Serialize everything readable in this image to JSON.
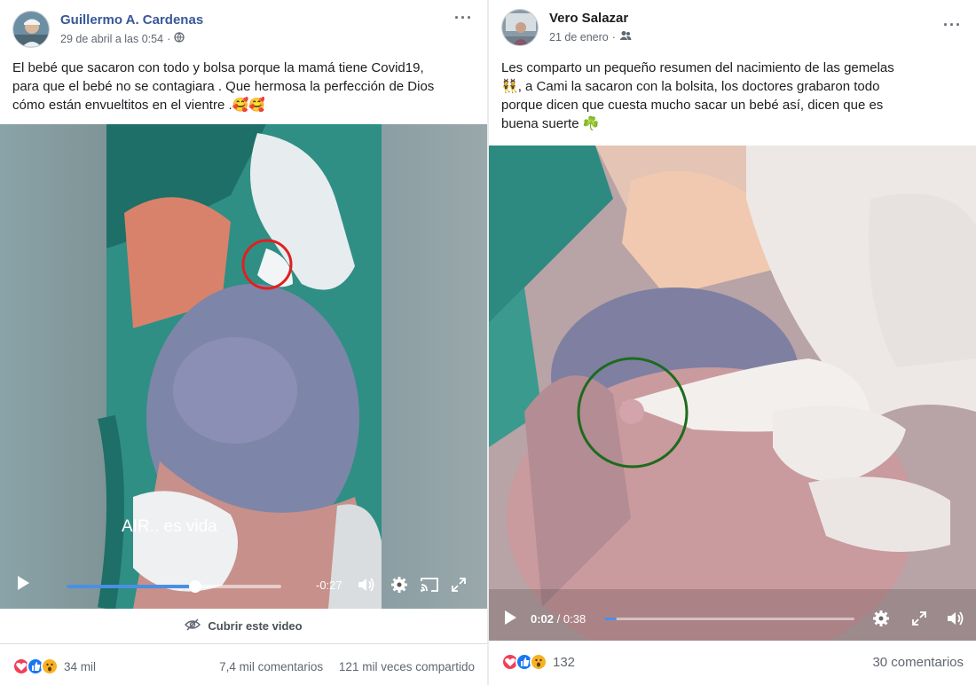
{
  "left_post": {
    "author": "Guillermo A. Cardenas",
    "timestamp": "29 de abril a las 0:54",
    "audience_icon": "globe-icon",
    "caption_lines": [
      "El bebé que sacaron con todo y bolsa porque la mamá tiene Covid19,",
      "para que el bebé no se contagiara . Que hermosa la perfección de Dios",
      "cómo están envueltitos en el vientre ."
    ],
    "caption_emoji": "🥰🥰",
    "video": {
      "overlay_text": "AIR.. es vida",
      "time_remaining": "-0:27",
      "progress": 0.6,
      "highlight_circle_color": "#e02020"
    },
    "cover_label": "Cubrir este video",
    "reaction_count": "34 mil",
    "comments": "7,4 mil comentarios",
    "shares": "121 mil veces compartido"
  },
  "right_post": {
    "author": "Vero Salazar",
    "timestamp": "21 de enero",
    "audience_icon": "friends-icon",
    "caption_lines": [
      "Les comparto un  pequeño resumen del nacimiento de las gemelas",
      ", a Cami la sacaron con la bolsita, los doctores grabaron todo",
      "porque dicen que cuesta mucho sacar un bebé así, dicen que es",
      "buena suerte"
    ],
    "caption_emoji_start": "👯",
    "caption_emoji_end": "☘️",
    "video": {
      "current_time": "0:02",
      "duration": "0:38",
      "separator": "/",
      "progress": 0.05,
      "highlight_circle_color": "#1d6b1d"
    },
    "reaction_count": "132",
    "comments": "30 comentarios"
  },
  "colors": {
    "link": "#385898",
    "like": "#1877f2",
    "love": "#f33e58",
    "wow": "#f7b125"
  }
}
